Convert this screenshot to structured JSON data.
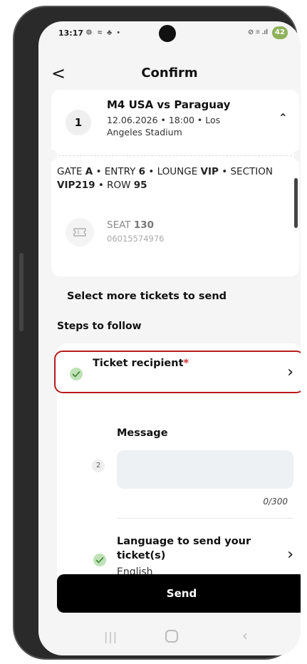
{
  "status_bar": {
    "time": "13:17",
    "left_icons": "☸ ≈ ♣ •",
    "right_icons": "⊘ ≡ .ıl",
    "battery": "42"
  },
  "header": {
    "back_icon": "<",
    "title": "Confirm"
  },
  "ticket": {
    "number": "1",
    "match_name": "M4 USA vs Paraguay",
    "match_meta": "12.06.2026 • 18:00 • Los Angeles Stadium",
    "gate_prefix": "GATE ",
    "gate": "A",
    "entry_prefix": " • ENTRY ",
    "entry": "6",
    "lounge_prefix": " • LOUNGE ",
    "lounge": "VIP",
    "section_prefix": " • SECTION ",
    "section": "VIP219",
    "row_prefix": " • ROW ",
    "row": "95",
    "seat_prefix": "SEAT ",
    "seat": "130",
    "ticket_code": "06015574976"
  },
  "select_more": "Select more tickets to send",
  "steps": {
    "title": "Steps to follow",
    "step1_label": "Ticket recipient",
    "step1_required": "*",
    "step2_number": "2",
    "step2_label": "Message",
    "message_count": "0/300",
    "step3_label_line1": "Language to send your",
    "step3_label_line2": "ticket(s)",
    "step3_value": "English"
  },
  "send_button": "Send",
  "colors": {
    "accent_red": "#b81b1b",
    "check_green": "#bfe2b6",
    "button_black": "#000000"
  },
  "icons": [
    "back-icon",
    "chevron-up-icon",
    "seat-ticket-icon",
    "check-icon",
    "chevron-right-icon",
    "recents-icon",
    "home-icon",
    "nav-back-icon"
  ]
}
